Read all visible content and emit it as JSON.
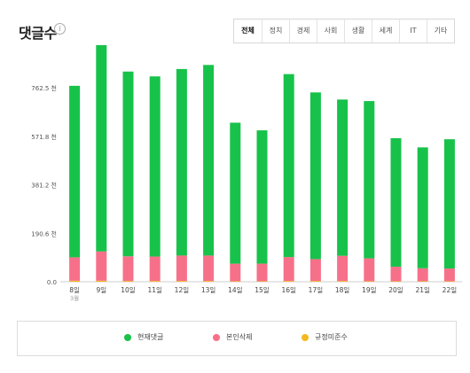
{
  "header": {
    "title": "댓글수",
    "info_icon": "info-icon",
    "tabs": [
      {
        "label": "전체",
        "active": true
      },
      {
        "label": "정치",
        "active": false
      },
      {
        "label": "경제",
        "active": false
      },
      {
        "label": "사회",
        "active": false
      },
      {
        "label": "생활",
        "active": false
      },
      {
        "label": "세계",
        "active": false
      },
      {
        "label": "IT",
        "active": false
      },
      {
        "label": "기타",
        "active": false
      }
    ]
  },
  "chart_data": {
    "type": "bar",
    "stacked": true,
    "categories": [
      "8일",
      "9일",
      "10일",
      "11일",
      "12일",
      "13일",
      "14일",
      "15일",
      "16일",
      "17일",
      "18일",
      "19일",
      "20일",
      "21일",
      "22일"
    ],
    "category_sublabels": {
      "8일": "3월"
    },
    "yticks": [
      "0.0",
      "190.6 천",
      "381.2 천",
      "571.8 천",
      "762.5 천"
    ],
    "ylim": [
      0,
      762.5
    ],
    "y_unit": "천",
    "grid": false,
    "legend_position": "bottom",
    "series": [
      {
        "name": "규정미준수",
        "color": "#f4b81f",
        "values": [
          4,
          4,
          3,
          3,
          3,
          3,
          2,
          2,
          3,
          3,
          3,
          2,
          2,
          2,
          2
        ]
      },
      {
        "name": "본인삭제",
        "color": "#f7708a",
        "values": [
          92,
          115,
          97,
          96,
          100,
          100,
          69,
          69,
          94,
          86,
          99,
          90,
          57,
          51,
          50
        ]
      },
      {
        "name": "현재댓글",
        "color": "#17c24a",
        "values": [
          674,
          811,
          726,
          708,
          733,
          749,
          554,
          524,
          719,
          655,
          614,
          618,
          505,
          475,
          508
        ]
      }
    ],
    "legend_order": [
      "현재댓글",
      "본인삭제",
      "규정미준수"
    ]
  }
}
